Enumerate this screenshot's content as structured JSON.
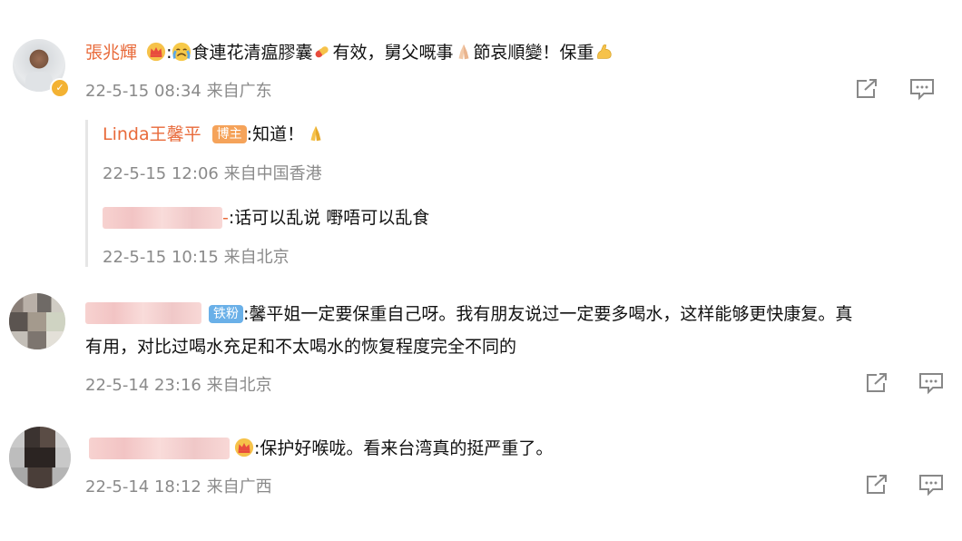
{
  "comments": [
    {
      "user": "張兆輝",
      "text_prefix": ":",
      "text_a": "食連花清瘟膠囊",
      "text_b": "有效，舅父嘅事",
      "text_c": "節哀順變！保重",
      "meta": "22-5-15 08:34 来自广东",
      "replies": [
        {
          "user": "Linda王馨平",
          "badge": "博主",
          "text": ":知道！",
          "meta": "22-5-15 12:06 来自中国香港"
        },
        {
          "user_suffix": "-",
          "text": ":话可以乱说 嘢唔可以乱食",
          "meta": "22-5-15 10:15 来自北京"
        }
      ]
    },
    {
      "badge": "铁粉",
      "text_line1": ":馨平姐一定要保重自己呀。我有朋友说过一定要多喝水，这样能够更快康复。真",
      "text_line2": "有用，对比过喝水充足和不太喝水的恢复程度完全不同的",
      "meta": "22-5-14 23:16 来自北京"
    },
    {
      "text": ":保护好喉咙。看来台湾真的挺严重了。",
      "meta": "22-5-14 18:12 来自广西"
    }
  ],
  "colors": {
    "name": "#e86a3a",
    "meta": "#8a8a8a",
    "badge_host": "#f5a35a",
    "badge_fan": "#6ab0e8"
  },
  "icons": [
    "crown-icon",
    "crying-face-icon",
    "pill-icon",
    "praying-hands-icon",
    "flexed-arm-icon",
    "share-icon",
    "comment-icon",
    "verified-icon"
  ]
}
